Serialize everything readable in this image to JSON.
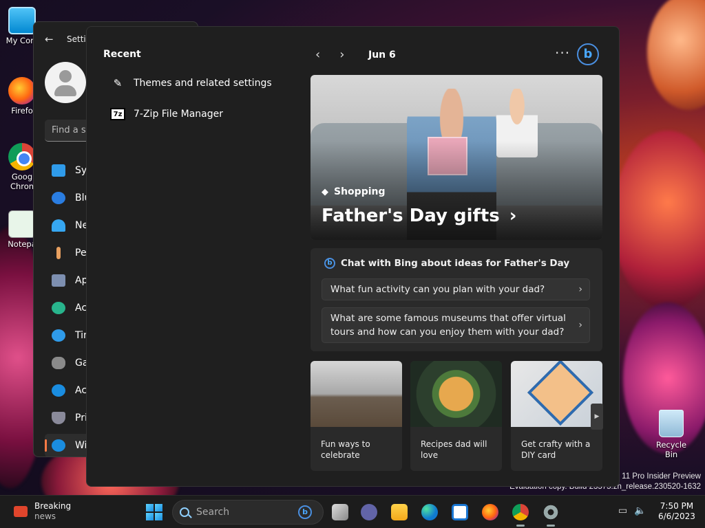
{
  "desktop": {
    "icons": [
      {
        "label": "My Com",
        "icon": "computer-icon"
      },
      {
        "label": "Firefo",
        "icon": "firefox-icon"
      },
      {
        "label": "Goog Chron",
        "icon": "chrome-icon"
      },
      {
        "label": "Notepa",
        "icon": "notepad-icon"
      }
    ],
    "recycle_bin": "Recycle Bin",
    "watermark_line1": "s 11 Pro Insider Preview",
    "watermark_line2": "Evaluation copy. Build 23575.zn_release.230520-1632"
  },
  "settings": {
    "back_icon": "back-arrow-icon",
    "title": "Settin",
    "find_placeholder": "Find a se",
    "nav": [
      {
        "label": "Sys",
        "color": "#2f9bea"
      },
      {
        "label": "Blu",
        "color": "#2a7de1"
      },
      {
        "label": "Ne",
        "color": "#36a7f2"
      },
      {
        "label": "Per",
        "color": "#e8a060"
      },
      {
        "label": "Ap",
        "color": "#7d8fb0"
      },
      {
        "label": "Ac",
        "color": "#28b48c"
      },
      {
        "label": "Tin",
        "color": "#2f9bea"
      },
      {
        "label": "Ga",
        "color": "#8a8a8a"
      },
      {
        "label": "Ac",
        "color": "#1a8de0"
      },
      {
        "label": "Pri",
        "color": "#8a8a9a"
      },
      {
        "label": "Wi",
        "color": "#1a8de0"
      }
    ]
  },
  "widgets": {
    "recent_title": "Recent",
    "recent_items": [
      {
        "label": "Themes and related settings",
        "icon": "brush-icon"
      },
      {
        "label": "7-Zip File Manager",
        "icon": "7zip-icon"
      }
    ],
    "date": "Jun 6",
    "more": "···",
    "bing_letter": "b",
    "hero": {
      "tag": "Shopping",
      "headline": "Father's Day gifts"
    },
    "chat": {
      "title": "Chat with Bing about ideas for Father's Day",
      "suggestions": [
        "What fun activity can you plan with your dad?",
        "What are some famous museums that offer virtual tours and how can you enjoy them with your dad?"
      ]
    },
    "cards": [
      {
        "caption": "Fun ways to celebrate"
      },
      {
        "caption": "Recipes dad will love"
      },
      {
        "caption": "Get crafty with a DIY card"
      }
    ],
    "scroll_glyph": "▶"
  },
  "taskbar": {
    "news_title": "Breaking",
    "news_sub": "news",
    "search_placeholder": "Search",
    "time": "7:50 PM",
    "date": "6/6/2023",
    "accent": "#1a8de0"
  }
}
